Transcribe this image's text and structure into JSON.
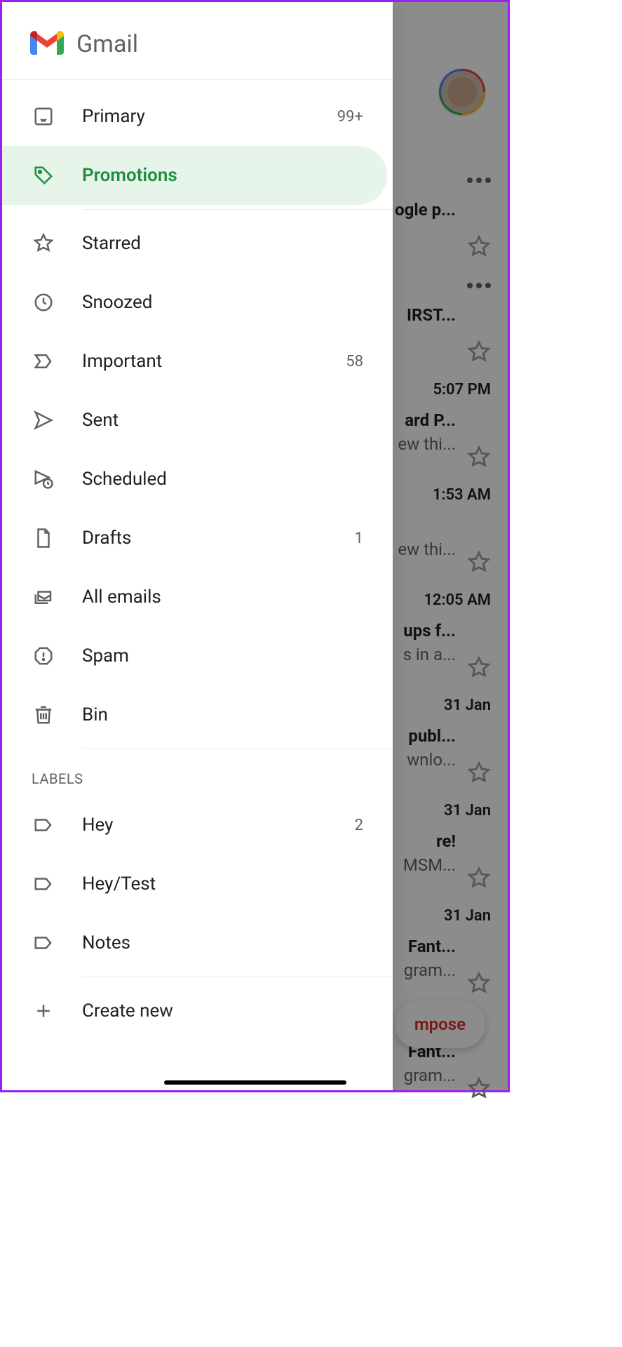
{
  "app_title": "Gmail",
  "compose_label": "mpose",
  "nav": {
    "groups": [
      {
        "items": [
          {
            "id": "primary",
            "label": "Primary",
            "count": "99+",
            "icon": "inbox",
            "selected": false
          },
          {
            "id": "promotions",
            "label": "Promotions",
            "count": "",
            "icon": "tag",
            "selected": true
          }
        ]
      },
      {
        "items": [
          {
            "id": "starred",
            "label": "Starred",
            "count": "",
            "icon": "star",
            "selected": false
          },
          {
            "id": "snoozed",
            "label": "Snoozed",
            "count": "",
            "icon": "clock",
            "selected": false
          },
          {
            "id": "important",
            "label": "Important",
            "count": "58",
            "icon": "important",
            "selected": false
          },
          {
            "id": "sent",
            "label": "Sent",
            "count": "",
            "icon": "send",
            "selected": false
          },
          {
            "id": "scheduled",
            "label": "Scheduled",
            "count": "",
            "icon": "scheduled",
            "selected": false
          },
          {
            "id": "drafts",
            "label": "Drafts",
            "count": "1",
            "icon": "file",
            "selected": false
          },
          {
            "id": "all",
            "label": "All emails",
            "count": "",
            "icon": "stack",
            "selected": false
          },
          {
            "id": "spam",
            "label": "Spam",
            "count": "",
            "icon": "spam",
            "selected": false
          },
          {
            "id": "bin",
            "label": "Bin",
            "count": "",
            "icon": "trash",
            "selected": false
          }
        ]
      }
    ],
    "labels_header": "LABELS",
    "labels": [
      {
        "id": "hey",
        "label": "Hey",
        "count": "2"
      },
      {
        "id": "heytest",
        "label": "Hey/Test",
        "count": ""
      },
      {
        "id": "notes",
        "label": "Notes",
        "count": ""
      }
    ],
    "create_new_label": "Create new"
  },
  "background_emails": [
    {
      "time": "",
      "subject": "ogle p...",
      "snippet": "",
      "dots": true
    },
    {
      "time": "",
      "subject": "IRST...",
      "snippet": "",
      "dots": true
    },
    {
      "time": "5:07 PM",
      "subject": "ard P...",
      "snippet": "ew thi..."
    },
    {
      "time": "1:53 AM",
      "subject": "",
      "snippet": "ew thi..."
    },
    {
      "time": "12:05 AM",
      "subject": "ups f...",
      "snippet": "s in a..."
    },
    {
      "time": "31 Jan",
      "subject": "publ...",
      "snippet": "wnlo..."
    },
    {
      "time": "31 Jan",
      "subject": "re!",
      "snippet": "MSM..."
    },
    {
      "time": "31 Jan",
      "subject": "Fant...",
      "snippet": "gram..."
    },
    {
      "time": "",
      "subject": "Fant...",
      "snippet": "gram..."
    }
  ]
}
